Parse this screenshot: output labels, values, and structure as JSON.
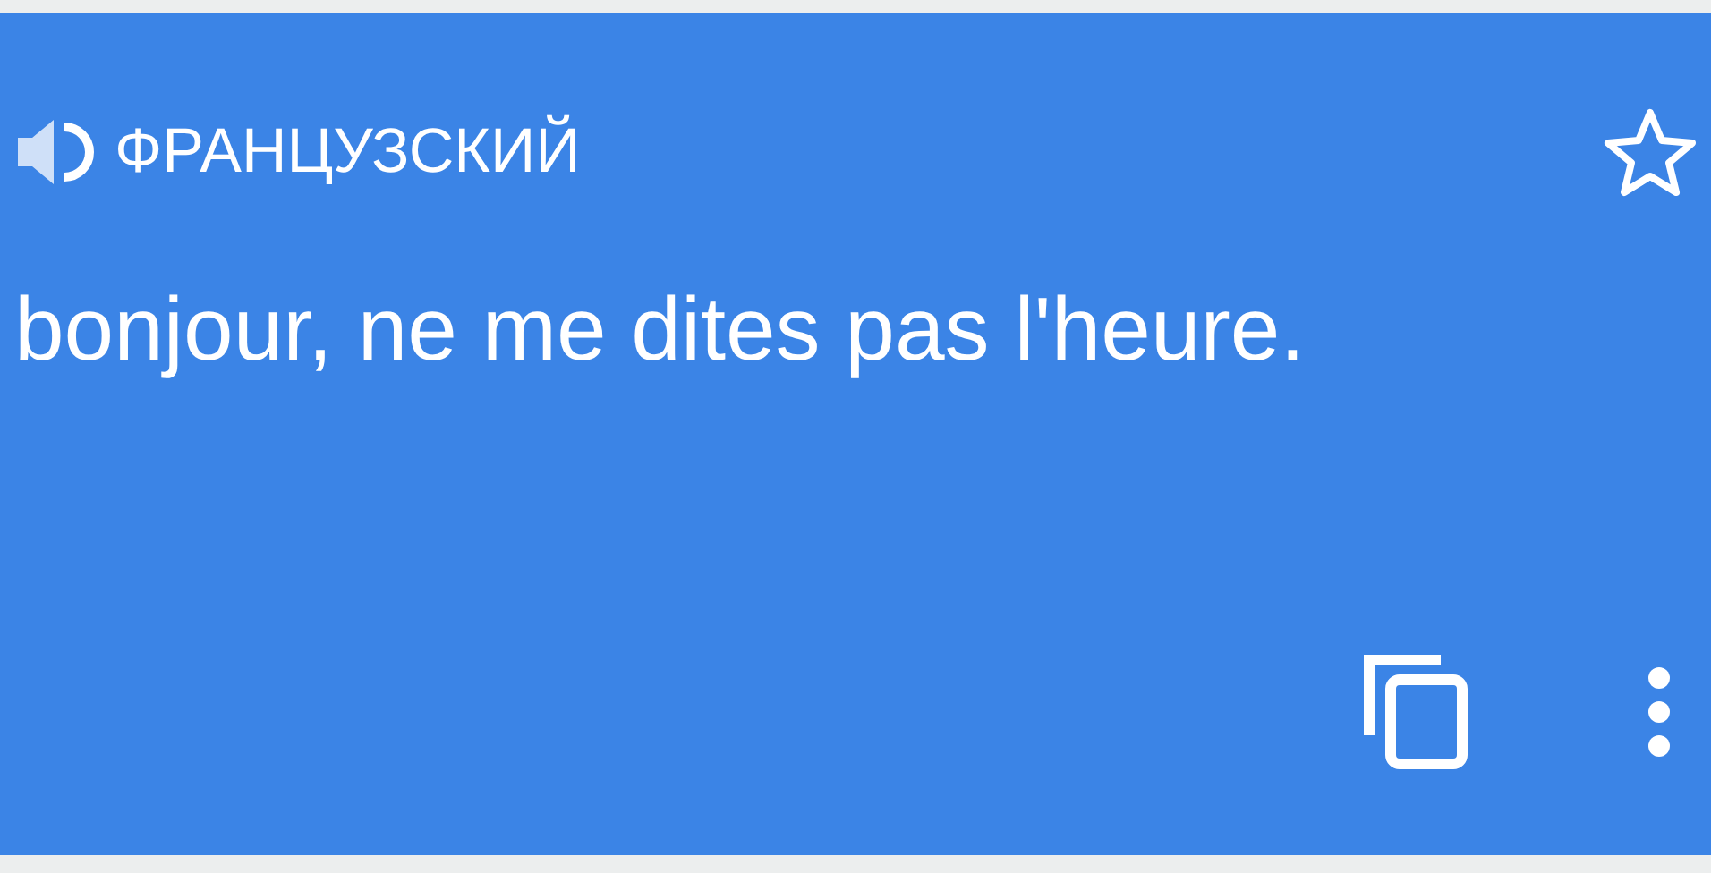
{
  "card": {
    "language": "ФРАНЦУЗСКИЙ",
    "starred": false,
    "translation": "bonjour, ne me dites pas l'heure."
  }
}
